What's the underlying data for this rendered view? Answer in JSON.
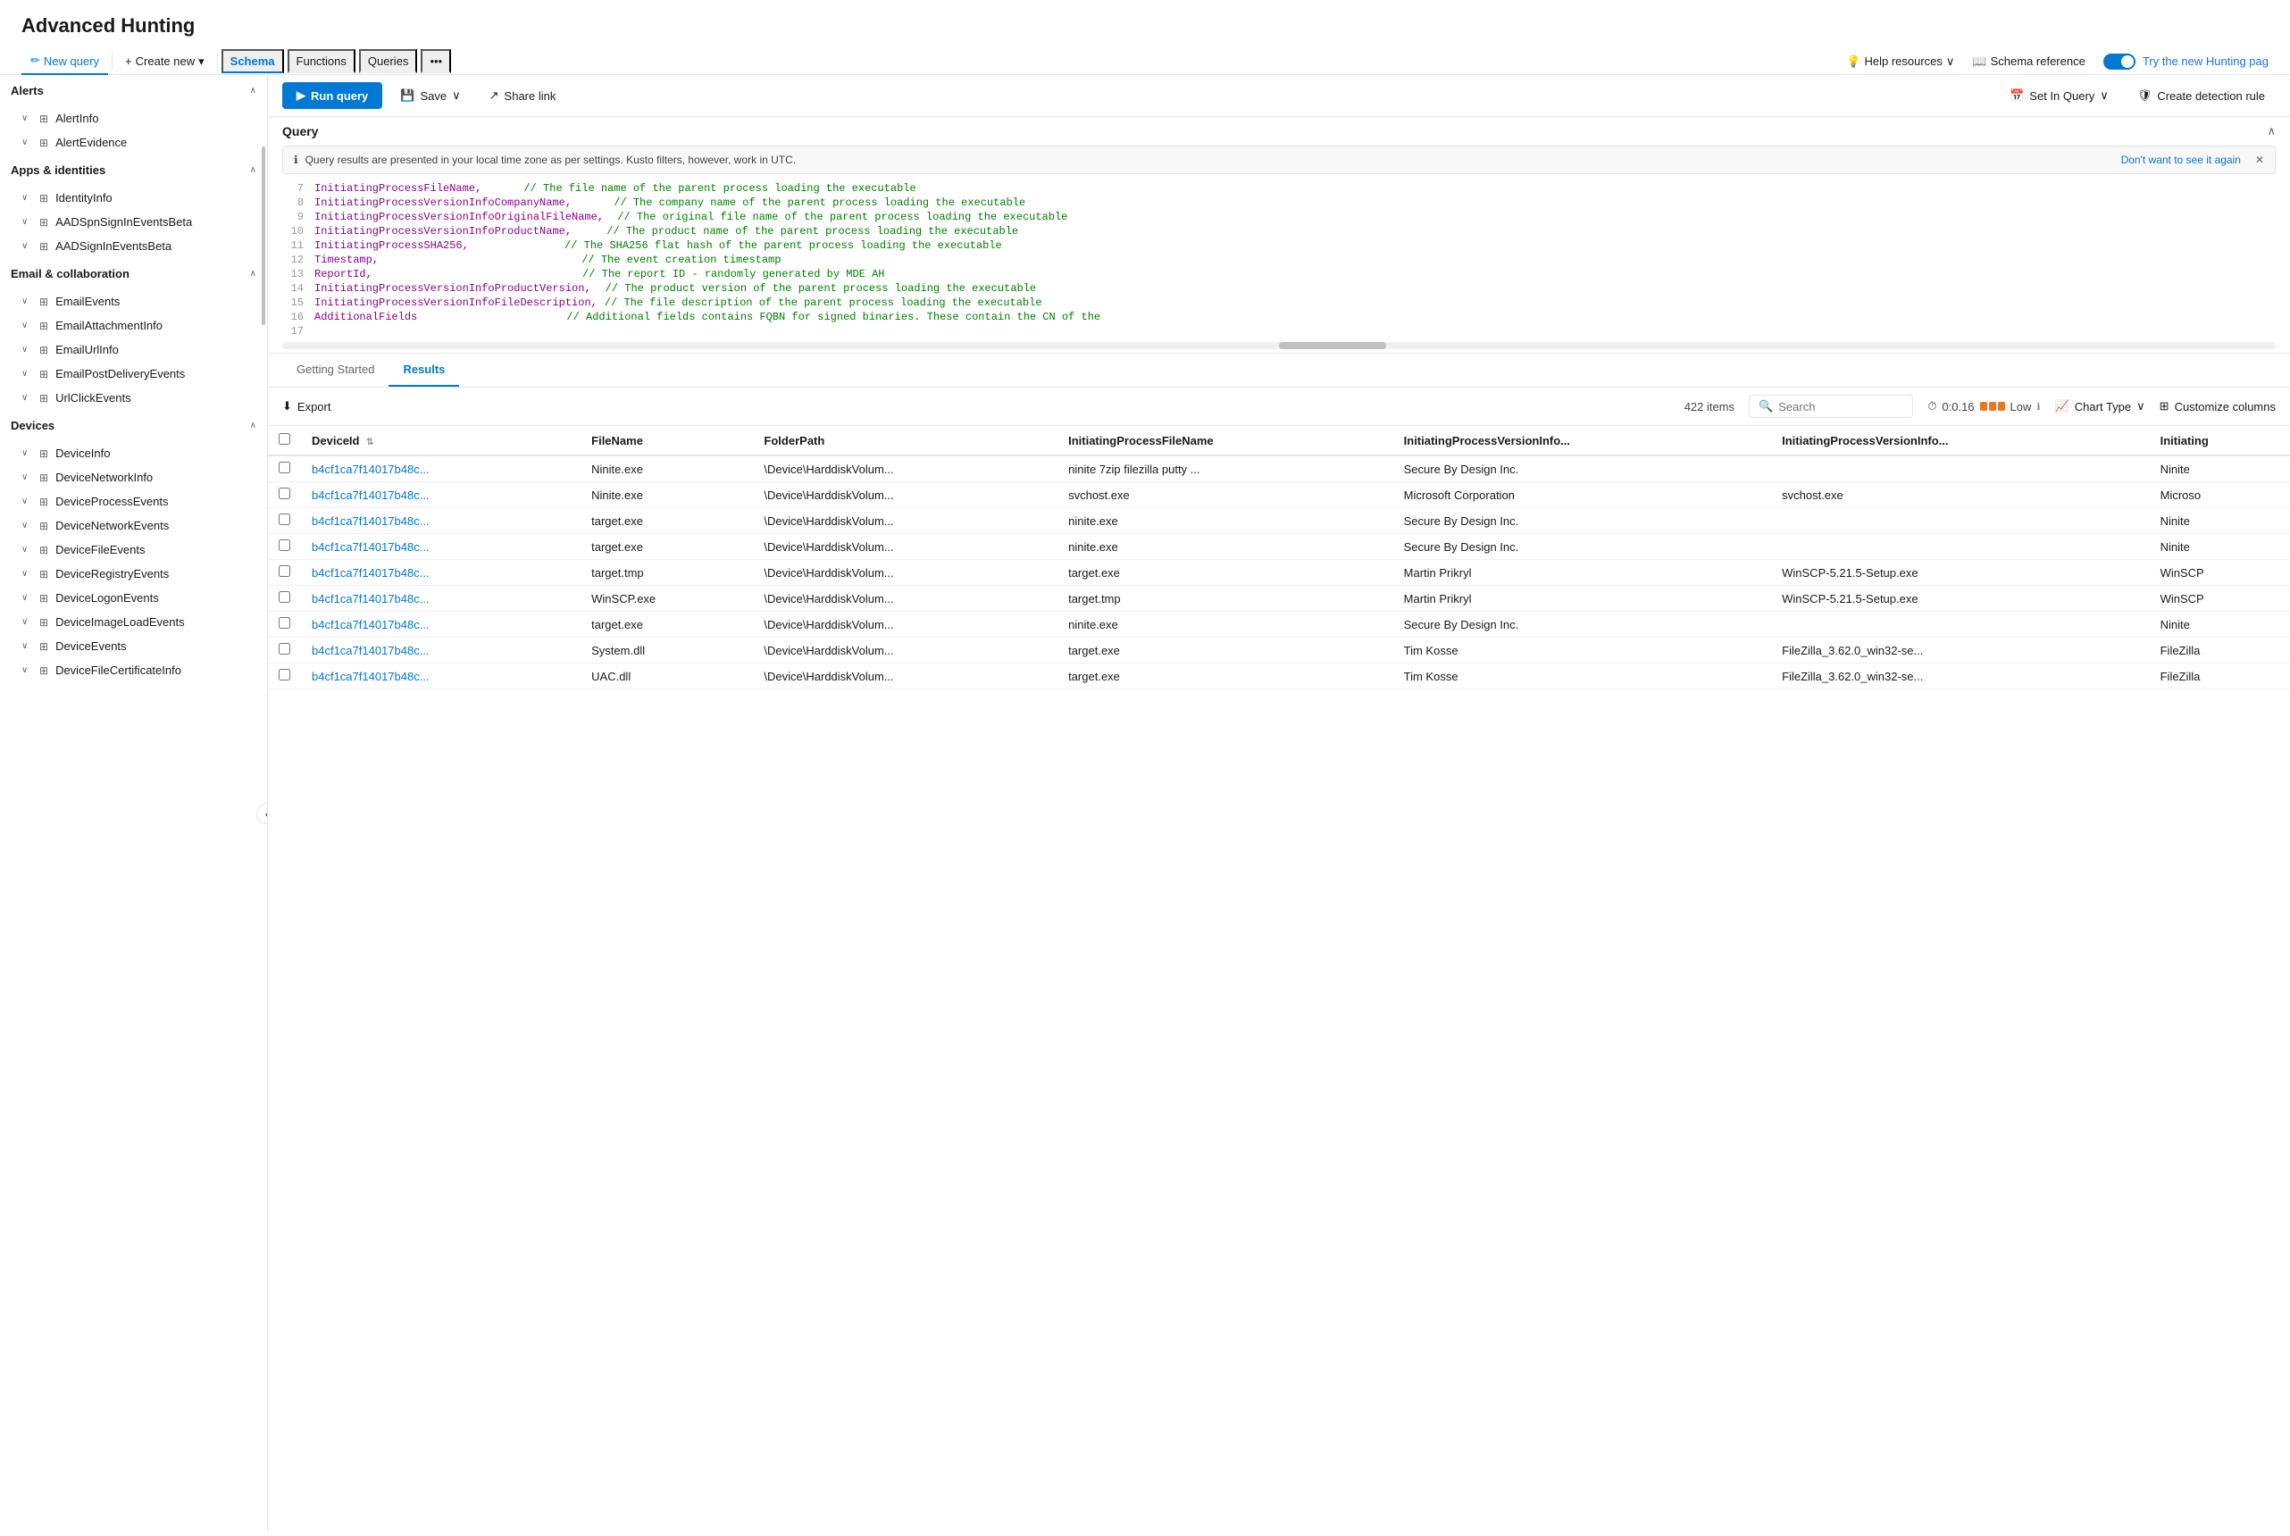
{
  "page": {
    "title": "Advanced Hunting"
  },
  "header": {
    "new_query": "New query",
    "create_new": "Create new",
    "help_resources": "Help resources",
    "schema_reference": "Schema reference",
    "try_new": "Try the new Hunting pag",
    "schema_tab": "Schema",
    "functions_tab": "Functions",
    "queries_tab": "Queries"
  },
  "toolbar": {
    "run": "Run query",
    "save": "Save",
    "share_link": "Share link",
    "set_in_query": "Set In Query",
    "create_detection_rule": "Create detection rule"
  },
  "query_section": {
    "title": "Query",
    "info_banner": "Query results are presented in your local time zone as per settings. Kusto filters, however, work in UTC.",
    "dont_show": "Don't want to see it again",
    "lines": [
      {
        "num": "7",
        "code": "InitiatingProcessFileName,",
        "comment": "// The file name of the parent process loading the executable",
        "color": "purple"
      },
      {
        "num": "8",
        "code": "InitiatingProcessVersionInfoCompanyName,",
        "comment": "// The company name of the parent process loading the executable",
        "color": "purple"
      },
      {
        "num": "9",
        "code": "InitiatingProcessVersionInfoOriginalFileName,",
        "comment": "// The original file name of the parent process loading the executable",
        "color": "purple"
      },
      {
        "num": "10",
        "code": "InitiatingProcessVersionInfoProductName,",
        "comment": "// The product name of the parent process loading the executable",
        "color": "purple"
      },
      {
        "num": "11",
        "code": "InitiatingProcessSHA256,",
        "comment": "// The SHA256 flat hash of the parent process loading the executable",
        "color": "purple"
      },
      {
        "num": "12",
        "code": "Timestamp,",
        "comment": "// The event creation timestamp",
        "color": "purple"
      },
      {
        "num": "13",
        "code": "ReportId,",
        "comment": "// The report ID - randomly generated by MDE AH",
        "color": "purple"
      },
      {
        "num": "14",
        "code": "InitiatingProcessVersionInfoProductVersion,",
        "comment": "// The product version of the parent process loading the executable",
        "color": "purple"
      },
      {
        "num": "15",
        "code": "InitiatingProcessVersionInfoFileDescription,",
        "comment": "// The file description of the parent process loading the executable",
        "color": "purple"
      },
      {
        "num": "16",
        "code": "AdditionalFields",
        "comment": "// Additional fields contains FQBN for signed binaries.  These contain the CN of the",
        "color": "purple"
      },
      {
        "num": "17",
        "code": "",
        "comment": "",
        "color": "normal"
      }
    ]
  },
  "results": {
    "getting_started_tab": "Getting Started",
    "results_tab": "Results",
    "export_label": "Export",
    "item_count": "422 items",
    "search_placeholder": "Search",
    "timing": "0:0.16",
    "timing_level": "Low",
    "chart_type": "Chart Type",
    "customize_columns": "Customize columns",
    "columns": [
      "DeviceId",
      "FileName",
      "FolderPath",
      "InitiatingProcessFileName",
      "InitiatingProcessVersionInfo...",
      "InitiatingProcessVersionInfo...",
      "Initiating"
    ],
    "rows": [
      {
        "deviceId": "b4cf1ca7f14017b48c...",
        "fileName": "Ninite.exe",
        "folderPath": "\\Device\\HarddiskVolum...",
        "initiatingFileName": "ninite 7zip filezilla putty ...",
        "versionInfo1": "Secure By Design Inc.",
        "versionInfo2": "",
        "initiating": "Ninite"
      },
      {
        "deviceId": "b4cf1ca7f14017b48c...",
        "fileName": "Ninite.exe",
        "folderPath": "\\Device\\HarddiskVolum...",
        "initiatingFileName": "svchost.exe",
        "versionInfo1": "Microsoft Corporation",
        "versionInfo2": "svchost.exe",
        "initiating": "Microso"
      },
      {
        "deviceId": "b4cf1ca7f14017b48c...",
        "fileName": "target.exe",
        "folderPath": "\\Device\\HarddiskVolum...",
        "initiatingFileName": "ninite.exe",
        "versionInfo1": "Secure By Design Inc.",
        "versionInfo2": "",
        "initiating": "Ninite"
      },
      {
        "deviceId": "b4cf1ca7f14017b48c...",
        "fileName": "target.exe",
        "folderPath": "\\Device\\HarddiskVolum...",
        "initiatingFileName": "ninite.exe",
        "versionInfo1": "Secure By Design Inc.",
        "versionInfo2": "",
        "initiating": "Ninite"
      },
      {
        "deviceId": "b4cf1ca7f14017b48c...",
        "fileName": "target.tmp",
        "folderPath": "\\Device\\HarddiskVolum...",
        "initiatingFileName": "target.exe",
        "versionInfo1": "Martin Prikryl",
        "versionInfo2": "WinSCP-5.21.5-Setup.exe",
        "initiating": "WinSCP"
      },
      {
        "deviceId": "b4cf1ca7f14017b48c...",
        "fileName": "WinSCP.exe",
        "folderPath": "\\Device\\HarddiskVolum...",
        "initiatingFileName": "target.tmp",
        "versionInfo1": "Martin Prikryl",
        "versionInfo2": "WinSCP-5.21.5-Setup.exe",
        "initiating": "WinSCP"
      },
      {
        "deviceId": "b4cf1ca7f14017b48c...",
        "fileName": "target.exe",
        "folderPath": "\\Device\\HarddiskVolum...",
        "initiatingFileName": "ninite.exe",
        "versionInfo1": "Secure By Design Inc.",
        "versionInfo2": "",
        "initiating": "Ninite"
      },
      {
        "deviceId": "b4cf1ca7f14017b48c...",
        "fileName": "System.dll",
        "folderPath": "\\Device\\HarddiskVolum...",
        "initiatingFileName": "target.exe",
        "versionInfo1": "Tim Kosse",
        "versionInfo2": "FileZilla_3.62.0_win32-se...",
        "initiating": "FileZilla"
      },
      {
        "deviceId": "b4cf1ca7f14017b48c...",
        "fileName": "UAC.dll",
        "folderPath": "\\Device\\HarddiskVolum...",
        "initiatingFileName": "target.exe",
        "versionInfo1": "Tim Kosse",
        "versionInfo2": "FileZilla_3.62.0_win32-se...",
        "initiating": "FileZilla"
      }
    ]
  },
  "sidebar": {
    "sections": [
      {
        "name": "Alerts",
        "expanded": true,
        "items": [
          {
            "label": "AlertInfo"
          },
          {
            "label": "AlertEvidence"
          }
        ]
      },
      {
        "name": "Apps & identities",
        "expanded": true,
        "items": [
          {
            "label": "IdentityInfo"
          },
          {
            "label": "AADSpnSignInEventsBeta"
          },
          {
            "label": "AADSignInEventsBeta"
          }
        ]
      },
      {
        "name": "Email & collaboration",
        "expanded": true,
        "items": [
          {
            "label": "EmailEvents"
          },
          {
            "label": "EmailAttachmentInfo"
          },
          {
            "label": "EmailUrlInfo"
          },
          {
            "label": "EmailPostDeliveryEvents"
          },
          {
            "label": "UrlClickEvents"
          }
        ]
      },
      {
        "name": "Devices",
        "expanded": true,
        "items": [
          {
            "label": "DeviceInfo"
          },
          {
            "label": "DeviceNetworkInfo"
          },
          {
            "label": "DeviceProcessEvents"
          },
          {
            "label": "DeviceNetworkEvents"
          },
          {
            "label": "DeviceFileEvents"
          },
          {
            "label": "DeviceRegistryEvents"
          },
          {
            "label": "DeviceLogonEvents"
          },
          {
            "label": "DeviceImageLoadEvents"
          },
          {
            "label": "DeviceEvents"
          },
          {
            "label": "DeviceFileCertificateInfo"
          }
        ]
      }
    ]
  }
}
